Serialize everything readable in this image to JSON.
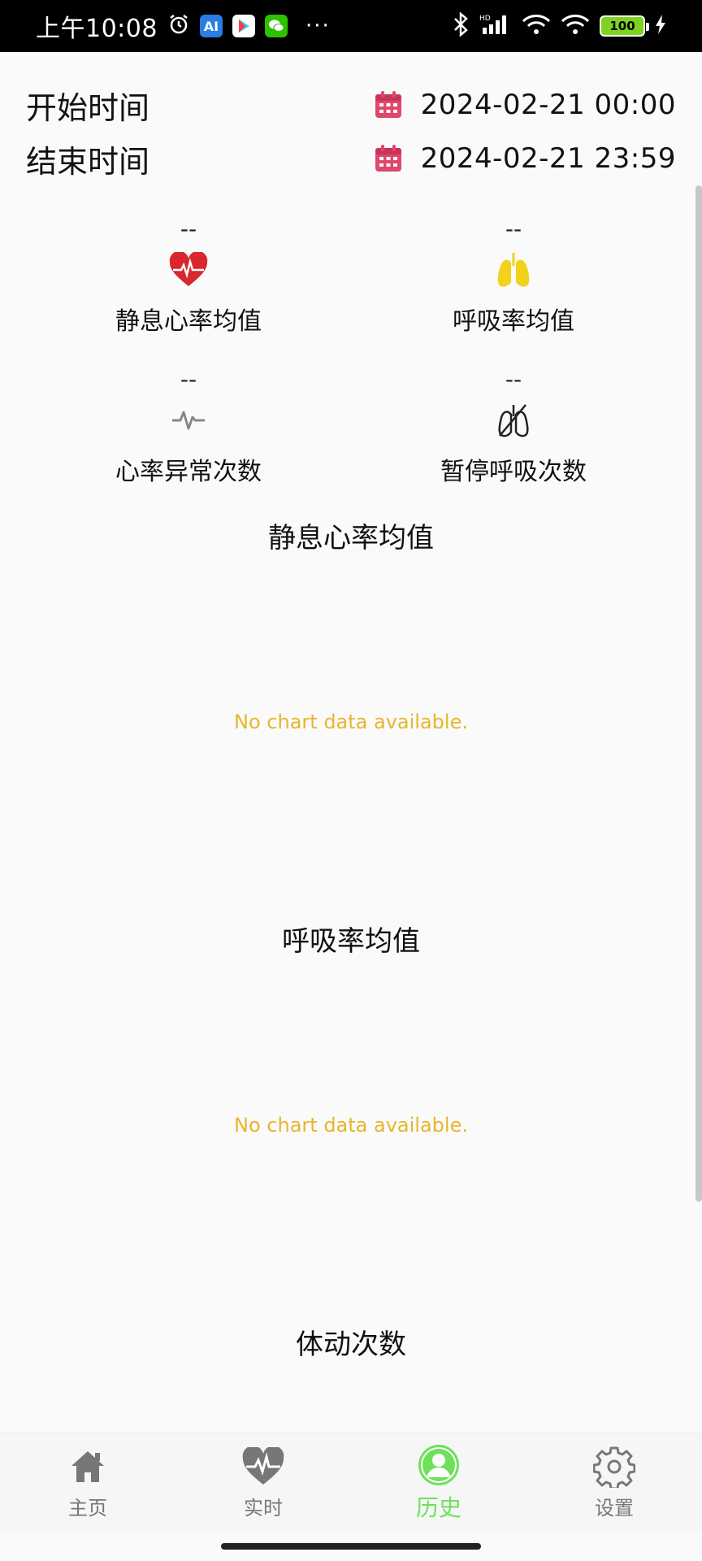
{
  "status_bar": {
    "time": "上午10:08",
    "ai_badge": "AI",
    "dots": "···",
    "battery": "100"
  },
  "time_range": {
    "start_label": "开始时间",
    "start_value": "2024-02-21 00:00",
    "end_label": "结束时间",
    "end_value": "2024-02-21 23:59"
  },
  "stats": [
    {
      "value": "--",
      "label": "静息心率均值",
      "icon": "heart-pulse-icon"
    },
    {
      "value": "--",
      "label": "呼吸率均值",
      "icon": "lungs-icon"
    },
    {
      "value": "--",
      "label": "心率异常次数",
      "icon": "pulse-line-icon"
    },
    {
      "value": "--",
      "label": "暂停呼吸次数",
      "icon": "lungs-crossed-icon"
    }
  ],
  "charts": [
    {
      "title": "静息心率均值",
      "empty_text": "No chart data available."
    },
    {
      "title": "呼吸率均值",
      "empty_text": "No chart data available."
    },
    {
      "title": "体动次数"
    }
  ],
  "nav": [
    {
      "label": "主页",
      "icon": "home-icon"
    },
    {
      "label": "实时",
      "icon": "heart-monitor-icon"
    },
    {
      "label": "历史",
      "icon": "user-circle-icon",
      "active": true
    },
    {
      "label": "设置",
      "icon": "gear-icon"
    }
  ],
  "colors": {
    "accent_green": "#6fe05a",
    "heart_red": "#d9262f",
    "lungs_yellow": "#f2d21b",
    "calendar_pink": "#e0476a",
    "empty_text": "#e6b62f"
  }
}
